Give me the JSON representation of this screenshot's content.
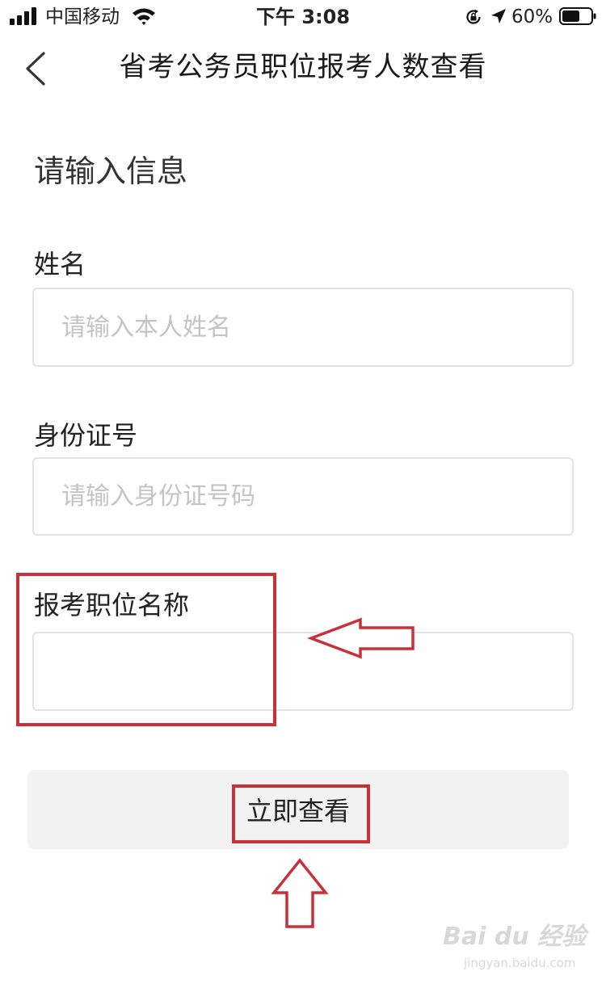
{
  "status_bar": {
    "carrier": "中国移动",
    "time": "下午 3:08",
    "battery_percent": "60%"
  },
  "nav": {
    "title": "省考公务员职位报考人数查看"
  },
  "form": {
    "heading": "请输入信息",
    "fields": [
      {
        "label": "姓名",
        "placeholder": "请输入本人姓名",
        "value": ""
      },
      {
        "label": "身份证号",
        "placeholder": "请输入身份证号码",
        "value": ""
      },
      {
        "label": "报考职位名称",
        "placeholder": "",
        "value": ""
      }
    ],
    "submit_label": "立即查看"
  },
  "watermark": {
    "logo": "Bai du 经验",
    "url": "jingyan.baidu.com"
  },
  "colors": {
    "annotation": "#c8303a",
    "input_border": "#e3e3e3",
    "placeholder": "#c4c4c4",
    "button_bg": "#f2f2f2"
  },
  "icons": [
    "signal-icon",
    "wifi-icon",
    "lock-rotation-icon",
    "location-icon",
    "battery-icon",
    "back-icon",
    "arrow-left-icon",
    "arrow-up-icon"
  ]
}
